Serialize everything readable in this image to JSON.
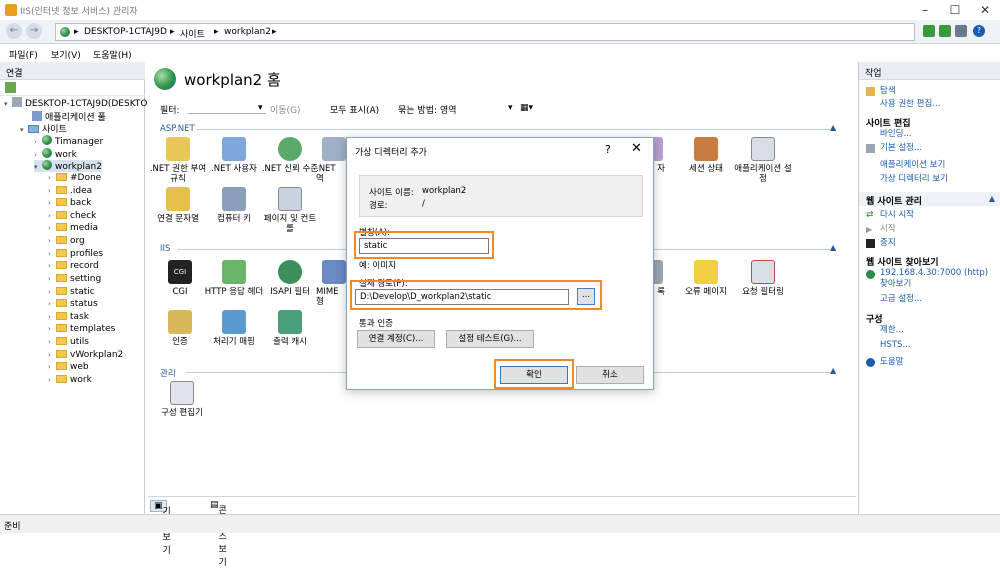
{
  "window": {
    "title": "IIS(인터넷 정보 서비스) 관리자"
  },
  "address": {
    "crumbs": [
      "DESKTOP-1CTAJ9D",
      "사이트",
      "workplan2"
    ]
  },
  "menu": {
    "items": [
      "파일(F)",
      "보기(V)",
      "도움말(H)"
    ]
  },
  "left": {
    "header": "연결",
    "server": "DESKTOP-1CTAJ9D(DESKTO",
    "app_pool": "애플리케이션 풀",
    "sites": "사이트",
    "site_list": [
      "Timanager",
      "work",
      "workplan2"
    ],
    "folders": [
      "#Done",
      ".idea",
      "back",
      "check",
      "media",
      "org",
      "profiles",
      "record",
      "setting",
      "static",
      "status",
      "task",
      "templates",
      "utils",
      "vWorkplan2",
      "web",
      "work"
    ]
  },
  "center": {
    "title": "workplan2 홈",
    "filter": {
      "label": "필터:",
      "go": "이동(G)",
      "show_all": "모두 표시(A)",
      "group_label": "묶는 방법:",
      "group_value": "영역"
    },
    "aspnet_header": "ASP.NET",
    "aspnet_row1": [
      ".NET 권한 부여 규칙",
      ".NET 사용자",
      ".NET 신뢰 수준",
      ".NET 역"
    ],
    "aspnet_row1_right": [
      "자",
      "세션 상태",
      "애플리케이션 설정"
    ],
    "aspnet_row2": [
      "연결 문자열",
      "컴퓨터 키",
      "페이지 및 컨트롤"
    ],
    "iis_header": "IIS",
    "iis_row1": [
      "CGI",
      "HTTP 응답 헤더",
      "ISAPI 필터",
      "MIME 형"
    ],
    "iis_row1_right": [
      "록",
      "오류 페이지",
      "요청 필터링"
    ],
    "iis_row2": [
      "인증",
      "처리기 매핑",
      "출력 캐시"
    ],
    "mgmt_header": "관리",
    "mgmt_row": [
      "구성 편집기"
    ],
    "tabs": {
      "features": "기능 보기",
      "content": "콘텐츠 보기"
    }
  },
  "right": {
    "header": "작업",
    "explore": "탐색",
    "edit_perms": "사용 권한 편집...",
    "site_edit_header": "사이트 편집",
    "bindings": "바인딩...",
    "basic_settings": "기본 설정...",
    "view_apps": "애플리케이션 보기",
    "view_vdirs": "가상 디렉터리 보기",
    "manage_header": "웹 사이트 관리",
    "restart": "다시 시작",
    "start": "시작",
    "stop": "중지",
    "browse_header": "웹 사이트 찾아보기",
    "browse_link": "192.168.4.30:7000 (http) 찾아보기",
    "advanced": "고급 설정...",
    "config_header": "구성",
    "limits": "제한...",
    "hsts": "HSTS...",
    "help": "도움말"
  },
  "dialog": {
    "title": "가상 디렉터리 추가",
    "site_name_label": "사이트 이름:",
    "site_name": "workplan2",
    "path_label": "경로:",
    "path": "/",
    "alias_label": "별칭(A):",
    "alias": "static",
    "example": "예: 이미지",
    "physical_path_label": "실제 경로(P):",
    "physical_path": "D:\\Develop\\D_workplan2\\static",
    "browse": "...",
    "passthrough_label": "통과 인증",
    "connect_as": "연결 계정(C)...",
    "test_settings": "설정 테스트(G)...",
    "ok": "확인",
    "cancel": "취소"
  },
  "status": {
    "text": "준비"
  }
}
